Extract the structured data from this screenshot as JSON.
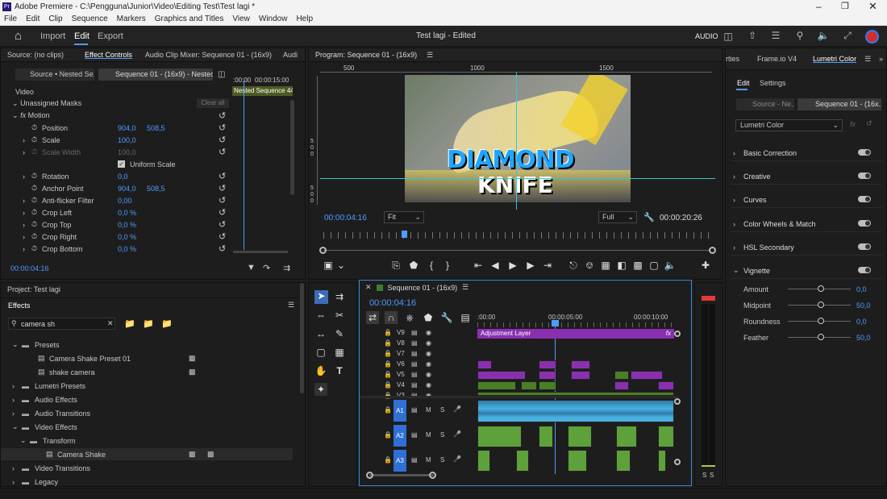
{
  "window": {
    "title": "Adobe Premiere - C:\\Pengguna\\Junior\\Video\\Editing Test\\Test lagi *"
  },
  "menu": [
    "File",
    "Edit",
    "Clip",
    "Sequence",
    "Markers",
    "Graphics and Titles",
    "View",
    "Window",
    "Help"
  ],
  "appbar": {
    "tabs": [
      "Import",
      "Edit",
      "Export"
    ],
    "active": "Edit",
    "project_title": "Test lagi - Edited",
    "audio_label": "AUDIO"
  },
  "effect_controls": {
    "tabs": [
      "Source: (no clips)",
      "Effect Controls",
      "Audio Clip Mixer: Sequence 01 - (16x9)",
      "Audi"
    ],
    "source_clip": "Source • Nested Se...",
    "sequence_clip": "Sequence 01 - (16x9) - Nested ...",
    "timecodes": [
      ":00:00",
      "00:00:15:00"
    ],
    "clip_bar": "Nested Sequence 44",
    "video_label": "Video",
    "masks": "Unassigned Masks",
    "clear_all": "Clear all",
    "motion": "Motion",
    "props": [
      {
        "name": "Position",
        "v1": "904,0",
        "v2": "508,5"
      },
      {
        "name": "Scale",
        "v1": "100,0",
        "v2": ""
      },
      {
        "name": "Scale Width",
        "v1": "100,0",
        "v2": ""
      },
      {
        "name": "Uniform Scale",
        "v1": "",
        "v2": ""
      },
      {
        "name": "Rotation",
        "v1": "0,0",
        "v2": ""
      },
      {
        "name": "Anchor Point",
        "v1": "904,0",
        "v2": "508,5"
      },
      {
        "name": "Anti-flicker Filter",
        "v1": "0,00",
        "v2": ""
      },
      {
        "name": "Crop Left",
        "v1": "0,0 %",
        "v2": ""
      },
      {
        "name": "Crop Top",
        "v1": "0,0 %",
        "v2": ""
      },
      {
        "name": "Crop Right",
        "v1": "0,0 %",
        "v2": ""
      },
      {
        "name": "Crop Bottom",
        "v1": "0,0 %",
        "v2": ""
      }
    ],
    "timecode": "00:00:04:16"
  },
  "program": {
    "tab": "Program: Sequence 01 - (16x9)",
    "ruler": [
      "500",
      "1000",
      "1500"
    ],
    "vruler": [
      "5",
      "0",
      "0",
      "5",
      "0",
      "0"
    ],
    "thumb_line1": "DIAMOND",
    "thumb_line2": "KNIFE",
    "timecode": "00:00:04:16",
    "fit": "Fit",
    "full": "Full",
    "duration": "00:00:20:26"
  },
  "right_panel": {
    "tabs": [
      "rties",
      "Frame.io V4",
      "Lumetri Color"
    ],
    "subtabs": [
      "Edit",
      "Settings"
    ],
    "source": "Source - Ne...",
    "sequence": "Sequence 01 - (16x...",
    "effect": "Lumetri Color",
    "sections": [
      "Basic Correction",
      "Creative",
      "Curves",
      "Color Wheels & Match",
      "HSL Secondary",
      "Vignette"
    ],
    "vignette": [
      {
        "name": "Amount",
        "value": "0,0"
      },
      {
        "name": "Midpoint",
        "value": "50,0"
      },
      {
        "name": "Roundness",
        "value": "0,0"
      },
      {
        "name": "Feather",
        "value": "50,0"
      }
    ]
  },
  "project": {
    "tab": "Project: Test lagi",
    "effects_tab": "Effects",
    "search": "camera sh",
    "tree": [
      {
        "label": "Presets",
        "indent": 0
      },
      {
        "label": "Camera Shake Preset 01",
        "indent": 1
      },
      {
        "label": "shake camera",
        "indent": 1
      },
      {
        "label": "Lumetri Presets",
        "indent": 0
      },
      {
        "label": "Audio Effects",
        "indent": 0
      },
      {
        "label": "Audio Transitions",
        "indent": 0
      },
      {
        "label": "Video Effects",
        "indent": 0
      },
      {
        "label": "Transform",
        "indent": 1
      },
      {
        "label": "Camera Shake",
        "indent": 2
      },
      {
        "label": "Video Transitions",
        "indent": 0
      },
      {
        "label": "Legacy",
        "indent": 0
      }
    ]
  },
  "timeline": {
    "tab": "Sequence 01 - (16x9)",
    "timecode": "00:00:04:16",
    "ruler": [
      ":00:00",
      "00:00:05:00",
      "00:00:10:00"
    ],
    "video_tracks": [
      "V9",
      "V8",
      "V7",
      "V6",
      "V5",
      "V4",
      "V3"
    ],
    "audio_tracks": [
      "A1",
      "A2",
      "A3"
    ],
    "adjustment": "Adjustment Layer",
    "fx": "fx",
    "m": "M",
    "s": "S"
  },
  "meter": {
    "labels": [
      "S",
      "S"
    ]
  }
}
